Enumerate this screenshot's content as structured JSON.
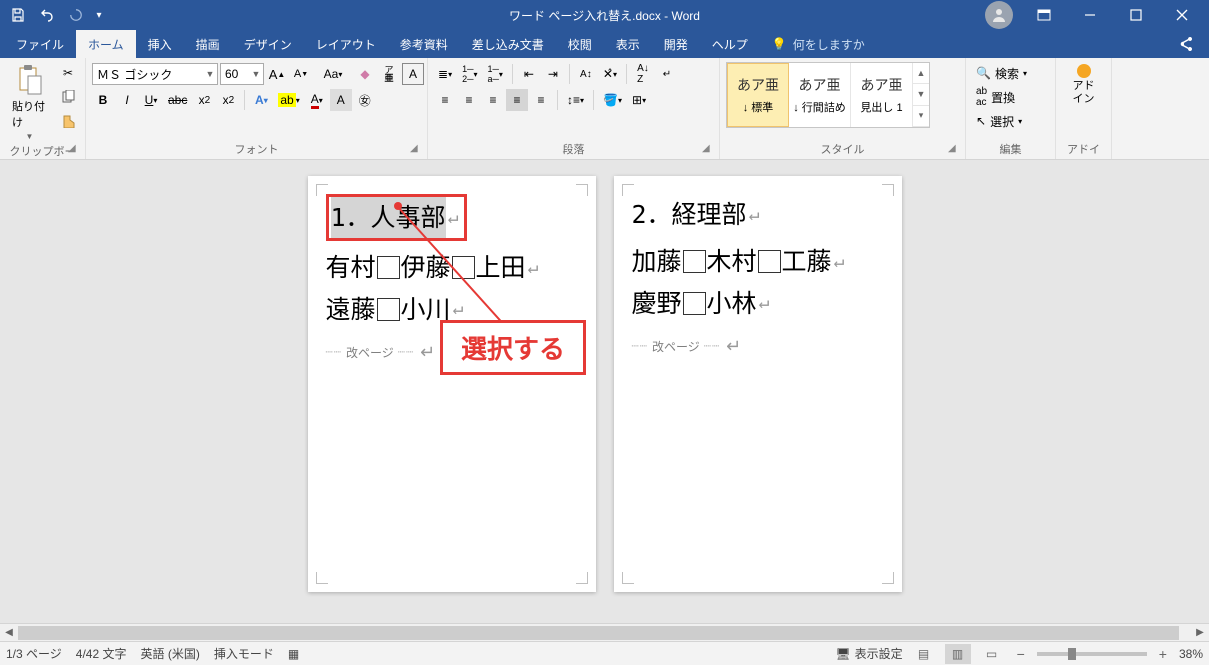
{
  "title": "ワード ページ入れ替え.docx - Word",
  "tabs": {
    "file": "ファイル",
    "home": "ホーム",
    "insert": "挿入",
    "draw": "描画",
    "design": "デザイン",
    "layout": "レイアウト",
    "references": "参考資料",
    "mailings": "差し込み文書",
    "review": "校閲",
    "view": "表示",
    "developer": "開発",
    "help": "ヘルプ",
    "tellme": "何をしますか",
    "share": "共有"
  },
  "ribbon": {
    "clipboard": {
      "label": "クリップボード",
      "paste": "貼り付け"
    },
    "font": {
      "label": "フォント",
      "name": "ＭＳ ゴシック",
      "size": "60"
    },
    "paragraph": {
      "label": "段落"
    },
    "styles": {
      "label": "スタイル",
      "items": [
        {
          "preview": "あア亜",
          "name": "↓ 標準"
        },
        {
          "preview": "あア亜",
          "name": "↓ 行間詰め"
        },
        {
          "preview": "あア亜",
          "name": "見出し 1"
        }
      ]
    },
    "editing": {
      "label": "編集",
      "find": "検索",
      "replace": "置換",
      "select": "選択"
    },
    "addin": {
      "label": "アドイン",
      "btn": "アド\nイン"
    }
  },
  "doc": {
    "page1": {
      "heading": "1．人事部",
      "line1a": "有村",
      "line1b": "伊藤",
      "line1c": "上田",
      "line2a": "遠藤",
      "line2b": "小川",
      "pagebreak": "改ページ"
    },
    "page2": {
      "heading": "2．経理部",
      "line1a": "加藤",
      "line1b": "木村",
      "line1c": "工藤",
      "line2a": "慶野",
      "line2b": "小林",
      "pagebreak": "改ページ"
    }
  },
  "annotation": "選択する",
  "status": {
    "page": "1/3 ページ",
    "words": "4/42 文字",
    "lang": "英語 (米国)",
    "mode": "挿入モード",
    "display": "表示設定",
    "zoom": "38%"
  }
}
